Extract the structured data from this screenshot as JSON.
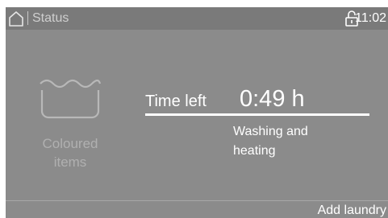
{
  "status_bar": {
    "title": "Status",
    "time": "11:02",
    "home_icon": "home-icon",
    "lock_icon": "unlocked-padlock-icon"
  },
  "programme": {
    "icon": "wash-tub-icon",
    "name_line1": "Coloured",
    "name_line2": "items"
  },
  "timer": {
    "label": "Time left",
    "value": "0:49 h",
    "progress": 1.0
  },
  "phase": {
    "line1": "Washing and",
    "line2": "heating"
  },
  "actions": {
    "add_laundry": "Add laundry"
  },
  "colors": {
    "background": "#8b8b8b",
    "status_bar": "#7a7a7a",
    "text": "#ffffff",
    "muted_text": "#b0b0b0"
  }
}
